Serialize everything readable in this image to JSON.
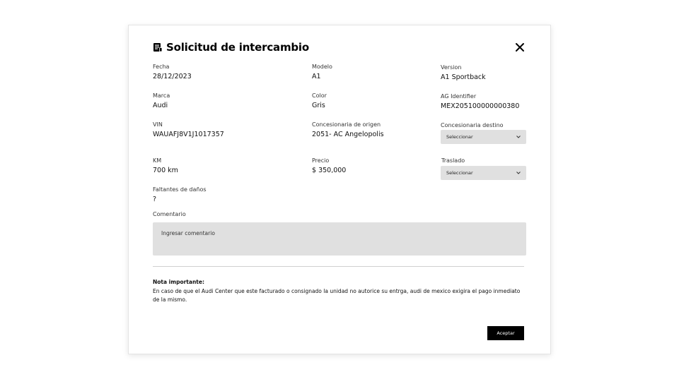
{
  "modal": {
    "title": "Solicitud de intercambio",
    "title_icon": "document-icon",
    "close_icon": "close-icon"
  },
  "fields": {
    "fecha": {
      "label": "Fecha",
      "value": "28/12/2023"
    },
    "modelo": {
      "label": "Modelo",
      "value": "A1"
    },
    "version": {
      "label": "Version",
      "value": "A1 Sportback"
    },
    "marca": {
      "label": "Marca",
      "value": "Audi"
    },
    "color": {
      "label": "Color",
      "value": "Gris"
    },
    "ag_identifier": {
      "label": "AG Identifier",
      "value": "MEX205100000000380"
    },
    "vin": {
      "label": "VIN",
      "value": "WAUAFJ8V1J1017357"
    },
    "concesionaria_origen": {
      "label": "Concesionaria de origen",
      "value": "2051- AC Angelopolis"
    },
    "concesionaria_destino": {
      "label": "Concesionaria destino",
      "selected": "Seleccionar"
    },
    "km": {
      "label": "KM",
      "value": "700 km"
    },
    "precio": {
      "label": "Precio",
      "value": "$ 350,000"
    },
    "traslado": {
      "label": "Traslado",
      "selected": "Seleccionar"
    },
    "faltantes": {
      "label": "Faltantes de daños",
      "value": "?"
    }
  },
  "comentario": {
    "label": "Comentario",
    "placeholder": "Ingresar comentario"
  },
  "nota": {
    "title": "Nota importante:",
    "text": "En caso de que el Audi Center que este facturado o consignado la unidad no autorice su entrga, audi de mexico exigira el pago inmediato de la mismo."
  },
  "actions": {
    "accept_label": "Aceptar"
  },
  "colors": {
    "input_bg": "#e0e0e0",
    "primary_button": "#000000"
  }
}
